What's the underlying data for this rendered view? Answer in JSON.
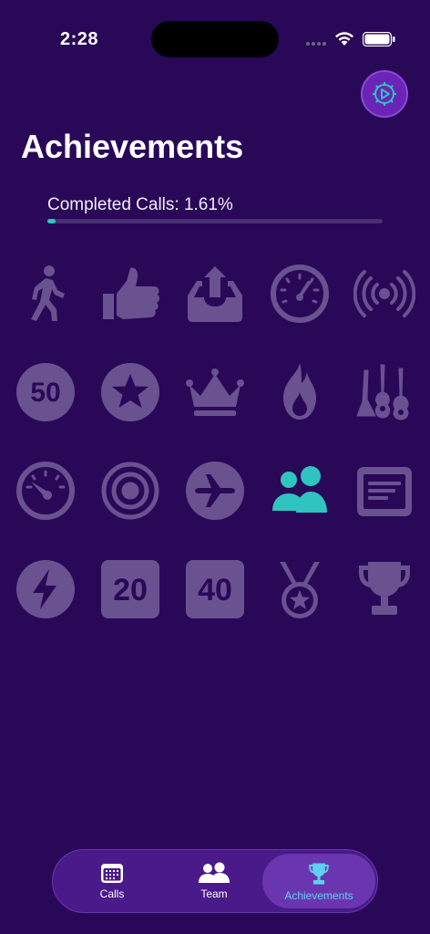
{
  "status": {
    "time": "2:28"
  },
  "page": {
    "title": "Achievements"
  },
  "progress": {
    "label": "Completed Calls: 1.61%",
    "value_percent": 1.61
  },
  "colors": {
    "background": "#2a0858",
    "locked_badge": "#6a5190",
    "unlocked_badge": "#2fc4c0",
    "accent": "#5ed0f0"
  },
  "badges": [
    {
      "icon": "walking-person-icon",
      "unlocked": false
    },
    {
      "icon": "thumbs-up-icon",
      "unlocked": false
    },
    {
      "icon": "tray-upload-icon",
      "unlocked": false
    },
    {
      "icon": "speedometer-icon",
      "unlocked": false
    },
    {
      "icon": "broadcast-icon",
      "unlocked": false
    },
    {
      "icon": "number-50-circle-icon",
      "text": "50",
      "unlocked": false
    },
    {
      "icon": "star-circle-icon",
      "unlocked": false
    },
    {
      "icon": "crown-icon",
      "unlocked": false
    },
    {
      "icon": "flame-icon",
      "unlocked": false
    },
    {
      "icon": "guitars-icon",
      "unlocked": false
    },
    {
      "icon": "gauge-icon",
      "unlocked": false
    },
    {
      "icon": "target-icon",
      "unlocked": false
    },
    {
      "icon": "airplane-circle-icon",
      "unlocked": false
    },
    {
      "icon": "people-icon",
      "unlocked": true
    },
    {
      "icon": "newspaper-icon",
      "unlocked": false
    },
    {
      "icon": "bolt-circle-icon",
      "unlocked": false
    },
    {
      "icon": "number-20-square-icon",
      "text": "20",
      "unlocked": false
    },
    {
      "icon": "number-40-square-icon",
      "text": "40",
      "unlocked": false
    },
    {
      "icon": "medal-icon",
      "unlocked": false
    },
    {
      "icon": "trophy-icon",
      "unlocked": false
    }
  ],
  "tabs": [
    {
      "label": "Calls",
      "icon": "calendar-icon",
      "selected": false
    },
    {
      "label": "Team",
      "icon": "people-icon",
      "selected": false
    },
    {
      "label": "Achievements",
      "icon": "trophy-icon",
      "selected": true
    }
  ]
}
